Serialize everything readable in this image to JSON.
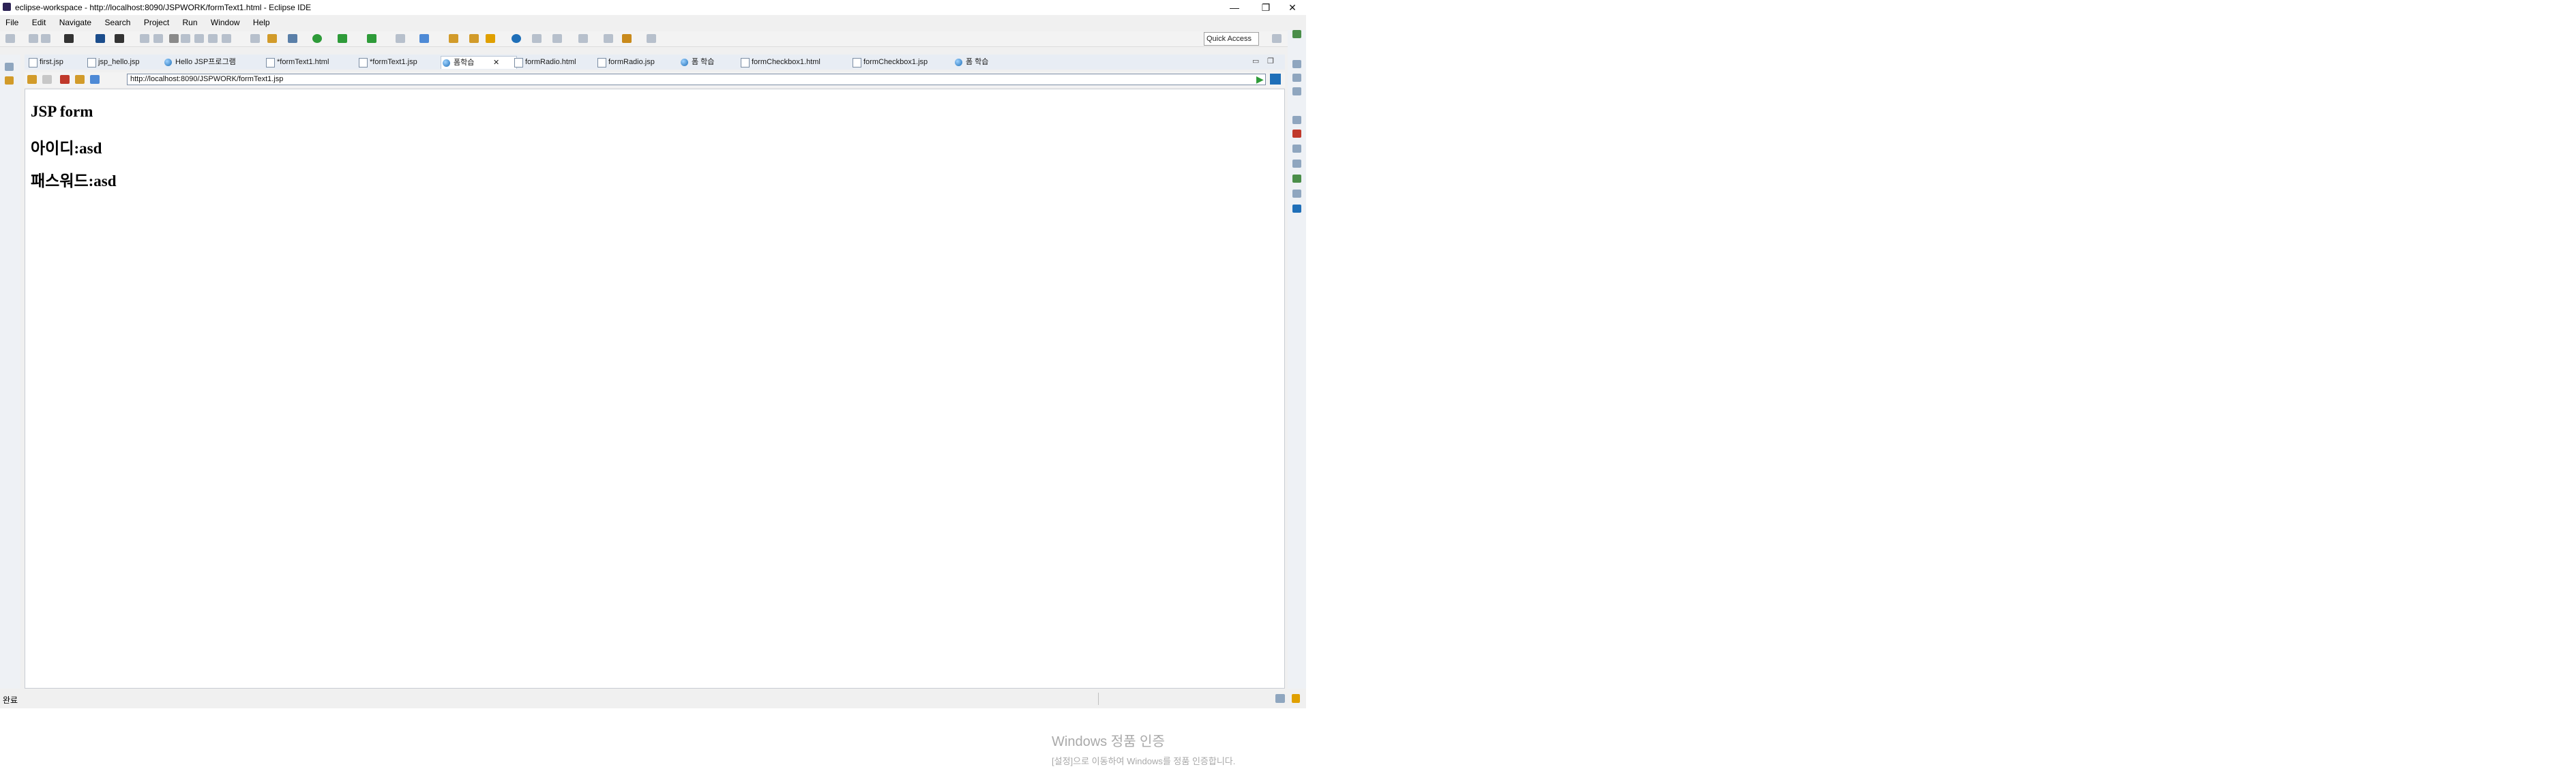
{
  "window": {
    "title": "eclipse-workspace - http://localhost:8090/JSPWORK/formText1.html - Eclipse IDE",
    "controls": [
      "—",
      "❐",
      "✕"
    ]
  },
  "menu": [
    "File",
    "Edit",
    "Navigate",
    "Search",
    "Project",
    "Run",
    "Window",
    "Help"
  ],
  "quick_access": "Quick Access",
  "tabs": [
    {
      "label": "first.jsp",
      "icon": "file-icon"
    },
    {
      "label": "jsp_hello.jsp",
      "icon": "file-icon"
    },
    {
      "label": "Hello JSP프로그램",
      "icon": "globe-icon"
    },
    {
      "label": "*formText1.html",
      "icon": "file-icon"
    },
    {
      "label": "*formText1.jsp",
      "icon": "file-icon"
    },
    {
      "label": "폼학습",
      "icon": "globe-icon",
      "active": true
    },
    {
      "label": "formRadio.html",
      "icon": "file-icon"
    },
    {
      "label": "formRadio.jsp",
      "icon": "file-icon"
    },
    {
      "label": "폼 학습",
      "icon": "globe-icon"
    },
    {
      "label": "formCheckbox1.html",
      "icon": "file-icon"
    },
    {
      "label": "formCheckbox1.jsp",
      "icon": "file-icon"
    },
    {
      "label": "폼 학습",
      "icon": "globe-icon"
    }
  ],
  "browser": {
    "url": "http://localhost:8090/JSPWORK/formText1.jsp"
  },
  "page": {
    "heading": "JSP form",
    "line1": "아이디:asd",
    "line2": "패스워드:asd"
  },
  "status": {
    "text": "완료"
  },
  "watermark": {
    "line1": "Windows 정품 인증",
    "line2": "[설정]으로 이동하여 Windows를 정품 인증합니다."
  },
  "colors": {
    "accent": "#1f6fb8",
    "tab_bar": "#e8edf4"
  }
}
